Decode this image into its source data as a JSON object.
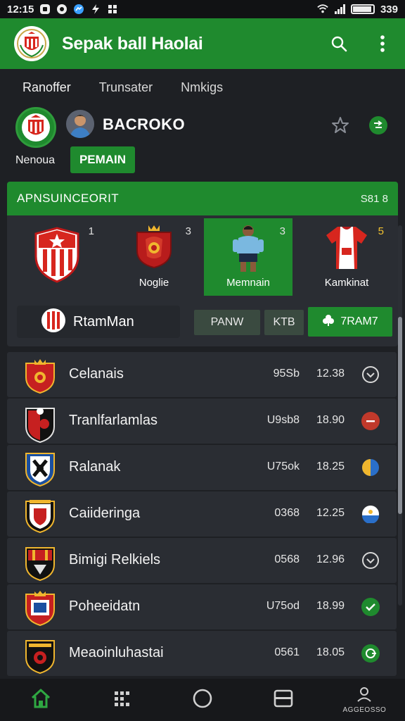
{
  "status_bar": {
    "time": "12:15",
    "signal": "339"
  },
  "app_bar": {
    "title": "Sepak ball Haolai"
  },
  "top_tabs": [
    {
      "label": "Ranoffer"
    },
    {
      "label": "Trunsater"
    },
    {
      "label": "Nmkigs"
    }
  ],
  "profile": {
    "club_label": "Nenoua",
    "name": "BACROKO",
    "role_button": "PEMAIN"
  },
  "panel": {
    "title": "APNSUINCEORIT",
    "count": "S81 8",
    "cards": [
      {
        "number": "1",
        "label": ""
      },
      {
        "number": "3",
        "label": "Noglie"
      },
      {
        "number": "3",
        "label": "Memnain"
      },
      {
        "number": "5",
        "label": "Kamkinat"
      }
    ],
    "featured_name": "RtamMan",
    "button_1": "PANW",
    "button_2": "KTB",
    "button_primary": "7RAM7"
  },
  "teams": [
    {
      "name": "Celanais",
      "code": "95Sb",
      "score": "12.38",
      "status_color": "#2a2d33"
    },
    {
      "name": "Tranlfarlamlas",
      "code": "U9sb8",
      "score": "18.90",
      "status_color": "#c0392b"
    },
    {
      "name": "Ralanak",
      "code": "U75ok",
      "score": "18.25",
      "status_color": "#f0b62e"
    },
    {
      "name": "Caiideringa",
      "code": "0368",
      "score": "12.25",
      "status_color": "#ffffff"
    },
    {
      "name": "Bimigi Relkiels",
      "code": "0568",
      "score": "12.96",
      "status_color": "#2a2d33"
    },
    {
      "name": "Poheeidatn",
      "code": "U75od",
      "score": "18.99",
      "status_color": "#1f8a2e"
    },
    {
      "name": "Meaoinluhastai",
      "code": "0561",
      "score": "18.05",
      "status_color": "#1f8a2e"
    }
  ],
  "bottom_nav": {
    "profile_label": "AGGEOSSO"
  }
}
